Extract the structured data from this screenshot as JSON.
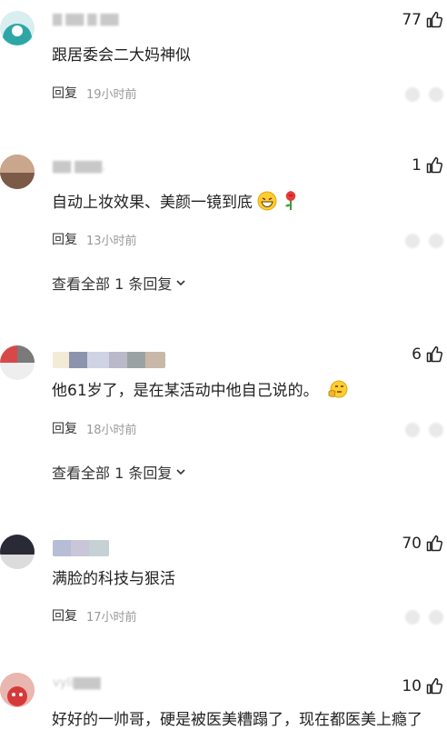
{
  "comments": [
    {
      "likes": "77",
      "text": "跟居委会二大妈神似",
      "reply_label": "回复",
      "time": "19小时前"
    },
    {
      "likes": "1",
      "text": "自动上妆效果、美颜一镜到底",
      "reply_label": "回复",
      "time": "13小时前",
      "view_replies": "查看全部 1 条回复"
    },
    {
      "likes": "6",
      "text": "他61岁了，是在某活动中他自己说的。",
      "reply_label": "回复",
      "time": "18小时前",
      "view_replies": "查看全部 1 条回复"
    },
    {
      "likes": "70",
      "text": "满脸的科技与狠活",
      "reply_label": "回复",
      "time": "17小时前"
    },
    {
      "likes": "10",
      "text": "好好的一帅哥，硬是被医美糟蹋了，现在都医美上瘾了"
    }
  ],
  "icons": {
    "like": "thumbs-up-icon",
    "expand": "chevron-down-icon"
  },
  "colors": {
    "text": "#222222",
    "secondary": "#999999"
  }
}
